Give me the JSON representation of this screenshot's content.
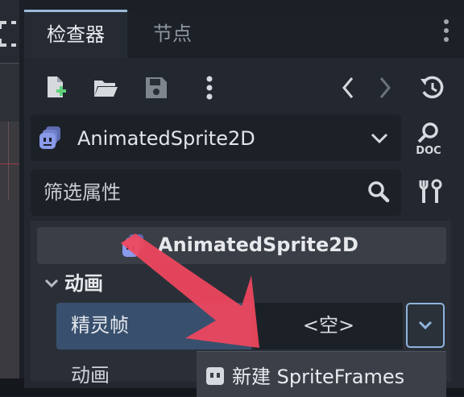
{
  "tabs": {
    "inspector": "检查器",
    "node": "节点"
  },
  "toolbar": {
    "new_resource_icon": "file-plus-icon",
    "open_icon": "folder-icon",
    "save_icon": "save-icon",
    "more_icon": "more-vertical-icon",
    "back_icon": "chevron-left-icon",
    "forward_icon": "chevron-right-icon",
    "history_icon": "history-icon"
  },
  "object_selector": {
    "name": "AnimatedSprite2D",
    "icon": "animated-sprite-icon",
    "doc_label": "DOC"
  },
  "filter": {
    "placeholder": "筛选属性"
  },
  "class_header": {
    "title": "AnimatedSprite2D"
  },
  "section": {
    "title": "动画"
  },
  "properties": [
    {
      "label": "精灵帧",
      "value": "<空>"
    },
    {
      "label": "动画"
    }
  ],
  "popup": {
    "item": "新建 SpriteFrames"
  },
  "colors": {
    "accent": "#8fb4dc",
    "selected_row": "#38506d",
    "arrow": "#f0475e",
    "node_icon": "#8a9aea"
  }
}
